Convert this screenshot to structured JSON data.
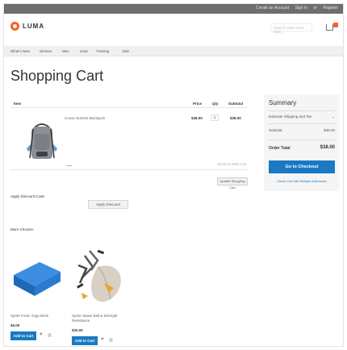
{
  "topbar": {
    "links": [
      "Create an Account",
      "Sign In",
      "or",
      "Register"
    ]
  },
  "header": {
    "logo_text": "LUMA",
    "search_placeholder": "Search entire store here...",
    "cart_icon": "cart-icon"
  },
  "nav": {
    "items": [
      "What's New",
      "Women",
      "Men",
      "Gear",
      "Training",
      "Sale"
    ]
  },
  "page_title": "Shopping Cart",
  "cart_table": {
    "headers": {
      "item": "Item",
      "price": "Price",
      "qty": "Qty",
      "subtotal": "Subtotal"
    },
    "items": [
      {
        "name": "Crown Summit Backpack",
        "price": "$38.00",
        "qty": "1",
        "subtotal": "$38.00"
      }
    ],
    "move_link": "Move to Wish List",
    "update_button": "Update Shopping Cart"
  },
  "discount": {
    "label": "Apply Discount Code",
    "button": "Apply Discount"
  },
  "summary": {
    "title": "Summary",
    "shipping_label": "Estimate Shipping and Tax",
    "subtotal_label": "Subtotal",
    "subtotal_value": "$38.00",
    "order_total_label": "Order Total",
    "order_total_value": "$38.00",
    "checkout_button": "Go to Checkout",
    "multi_link": "Check Out with Multiple Addresses"
  },
  "more": {
    "label": "More Choices:",
    "products": [
      {
        "name": "Sprite Foam Yoga Brick",
        "price": "$5.00",
        "add_button": "Add to Cart"
      },
      {
        "name": "Sprite Stasis Ball & Strength Resistance",
        "price": "$32.00",
        "add_button": "Add to Cart"
      }
    ]
  },
  "colors": {
    "accent": "#1979c3",
    "brand": "#f26322",
    "topbar": "#6e6e6e"
  }
}
